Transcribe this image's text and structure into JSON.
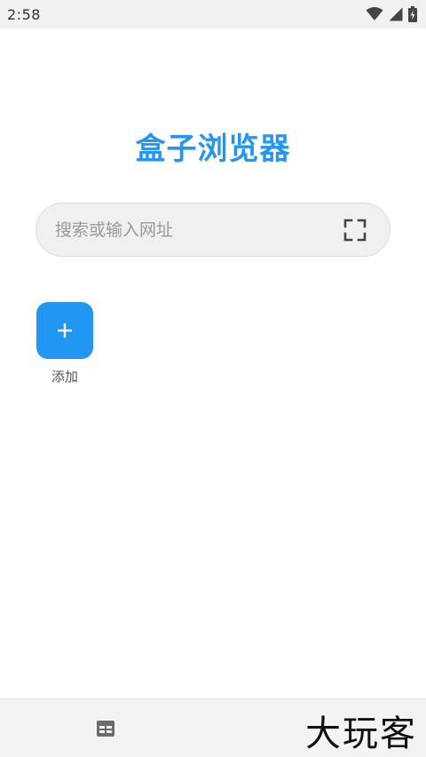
{
  "status_bar": {
    "time": "2:58",
    "icons": [
      "wifi-icon",
      "signal-icon",
      "battery-charging-icon"
    ]
  },
  "app": {
    "title": "盒子浏览器"
  },
  "search": {
    "placeholder": "搜索或输入网址",
    "value": "",
    "scan_icon": "scan-frame-icon"
  },
  "shortcuts": [
    {
      "label": "添加",
      "icon": "plus-icon"
    }
  ],
  "bottom_bar": {
    "tabs_icon": "tabs-grid-icon",
    "watermark": "大玩客"
  },
  "colors": {
    "accent": "#2196f3",
    "status_bar_bg": "#f1f1f1",
    "search_bg": "#f0f0f0",
    "bottom_bar_bg": "#f3f3f3"
  }
}
